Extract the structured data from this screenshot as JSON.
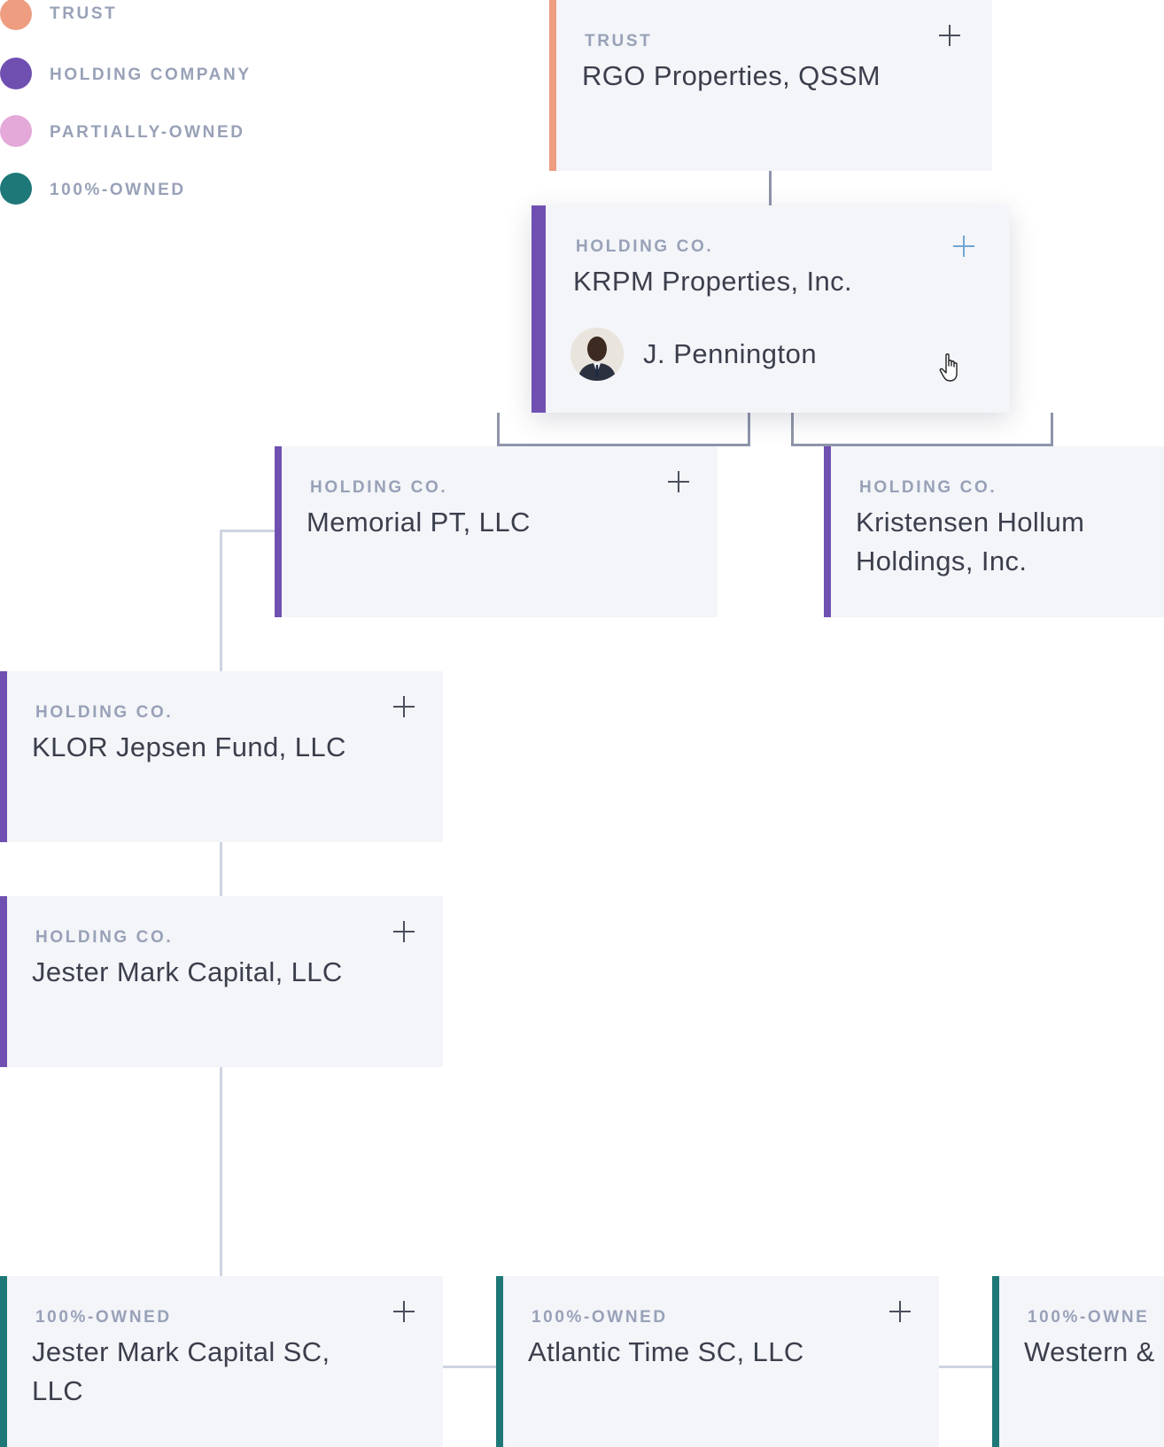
{
  "legend": [
    {
      "label": "TRUST",
      "color": "#ee9d80"
    },
    {
      "label": "HOLDING COMPANY",
      "color": "#6f50b1"
    },
    {
      "label": "PARTIALLY-OWNED",
      "color": "#e4a8d9"
    },
    {
      "label": "100%-OWNED",
      "color": "#1e7878"
    }
  ],
  "nodes": {
    "rgo": {
      "type": "TRUST",
      "name": "RGO Properties, QSSM",
      "color": "#ee9d80"
    },
    "krpm": {
      "type": "HOLDING CO.",
      "name": "KRPM Properties, Inc.",
      "color": "#6f50b1",
      "person": "J. Pennington"
    },
    "memorial": {
      "type": "HOLDING CO.",
      "name": "Memorial PT, LLC",
      "color": "#6f50b1"
    },
    "kristensen": {
      "type": "HOLDING CO.",
      "name": "Kristensen Hollum Holdings, Inc.",
      "color": "#6f50b1"
    },
    "klor": {
      "type": "HOLDING CO.",
      "name": "KLOR Jepsen Fund, LLC",
      "color": "#6f50b1"
    },
    "jester": {
      "type": "HOLDING CO.",
      "name": "Jester Mark Capital, LLC",
      "color": "#6f50b1"
    },
    "jester_sc": {
      "type": "100%-OWNED",
      "name": "Jester Mark Capital SC, LLC",
      "color": "#1e7878"
    },
    "atlantic": {
      "type": "100%-OWNED",
      "name": "Atlantic Time SC, LLC",
      "color": "#1e7878"
    },
    "western": {
      "type": "100%-OWNE",
      "name": "Western &",
      "color": "#1e7878"
    }
  }
}
